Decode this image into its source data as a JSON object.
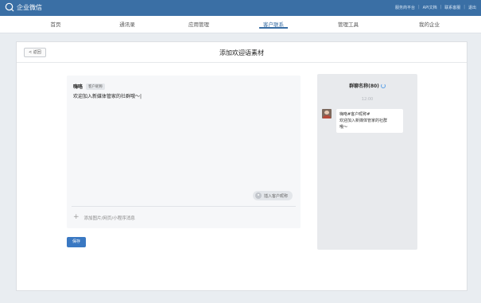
{
  "topbar": {
    "logo_text": "企业微信",
    "links": [
      "服务商平台",
      "API文档",
      "联系客服",
      "退出"
    ],
    "separator": "|"
  },
  "nav": {
    "items": [
      "首页",
      "通讯录",
      "应用管理",
      "客户联系",
      "管理工具",
      "我的企业"
    ],
    "active": "客户联系"
  },
  "header": {
    "back_label": "< 返回",
    "title": "添加欢迎语素材"
  },
  "editor": {
    "greeting": "嗨咯",
    "tag_label": "客户昵称",
    "message": "欢迎加入新媒体管家的社群哦～|",
    "insert_label": "插入客户昵称",
    "add_media_icon": "+",
    "add_media_label": "添加图片/网页/小程序消息"
  },
  "save_label": "保存",
  "preview": {
    "title": "群聊名称(80)",
    "time": "12:00",
    "bubble_lines": [
      "嗨咯#客户昵称#",
      "欢迎加入新媒体管家的社群",
      "哦～"
    ]
  },
  "colors": {
    "brand": "#3a6fa5",
    "save_button": "#3a78c2",
    "spinner": "#5aa0e6"
  },
  "icons": [
    "wechat-work-logo-icon",
    "avatar-icon",
    "spinner-icon",
    "plus-icon",
    "user-icon"
  ]
}
